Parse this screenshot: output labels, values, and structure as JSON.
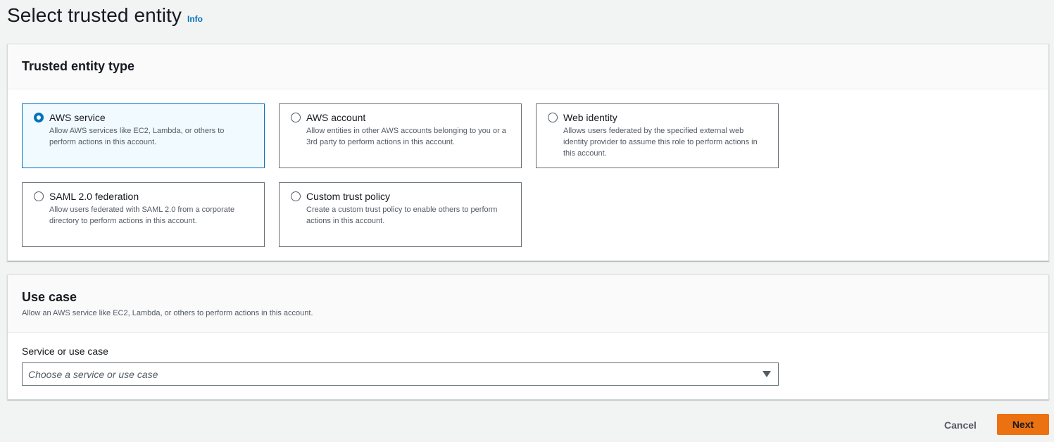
{
  "header": {
    "title": "Select trusted entity",
    "info_link": "Info"
  },
  "entity_panel": {
    "title": "Trusted entity type",
    "options": [
      {
        "label": "AWS service",
        "description": "Allow AWS services like EC2, Lambda, or others to perform actions in this account.",
        "selected": true
      },
      {
        "label": "AWS account",
        "description": "Allow entities in other AWS accounts belonging to you or a 3rd party to perform actions in this account.",
        "selected": false
      },
      {
        "label": "Web identity",
        "description": "Allows users federated by the specified external web identity provider to assume this role to perform actions in this account.",
        "selected": false
      },
      {
        "label": "SAML 2.0 federation",
        "description": "Allow users federated with SAML 2.0 from a corporate directory to perform actions in this account.",
        "selected": false
      },
      {
        "label": "Custom trust policy",
        "description": "Create a custom trust policy to enable others to perform actions in this account.",
        "selected": false
      }
    ]
  },
  "usecase_panel": {
    "title": "Use case",
    "description": "Allow an AWS service like EC2, Lambda, or others to perform actions in this account.",
    "field_label": "Service or use case",
    "select_placeholder": "Choose a service or use case"
  },
  "footer": {
    "cancel_label": "Cancel",
    "next_label": "Next"
  },
  "colors": {
    "accent": "#0073bb",
    "primary_button": "#ec7211",
    "background": "#f2f3f3"
  }
}
